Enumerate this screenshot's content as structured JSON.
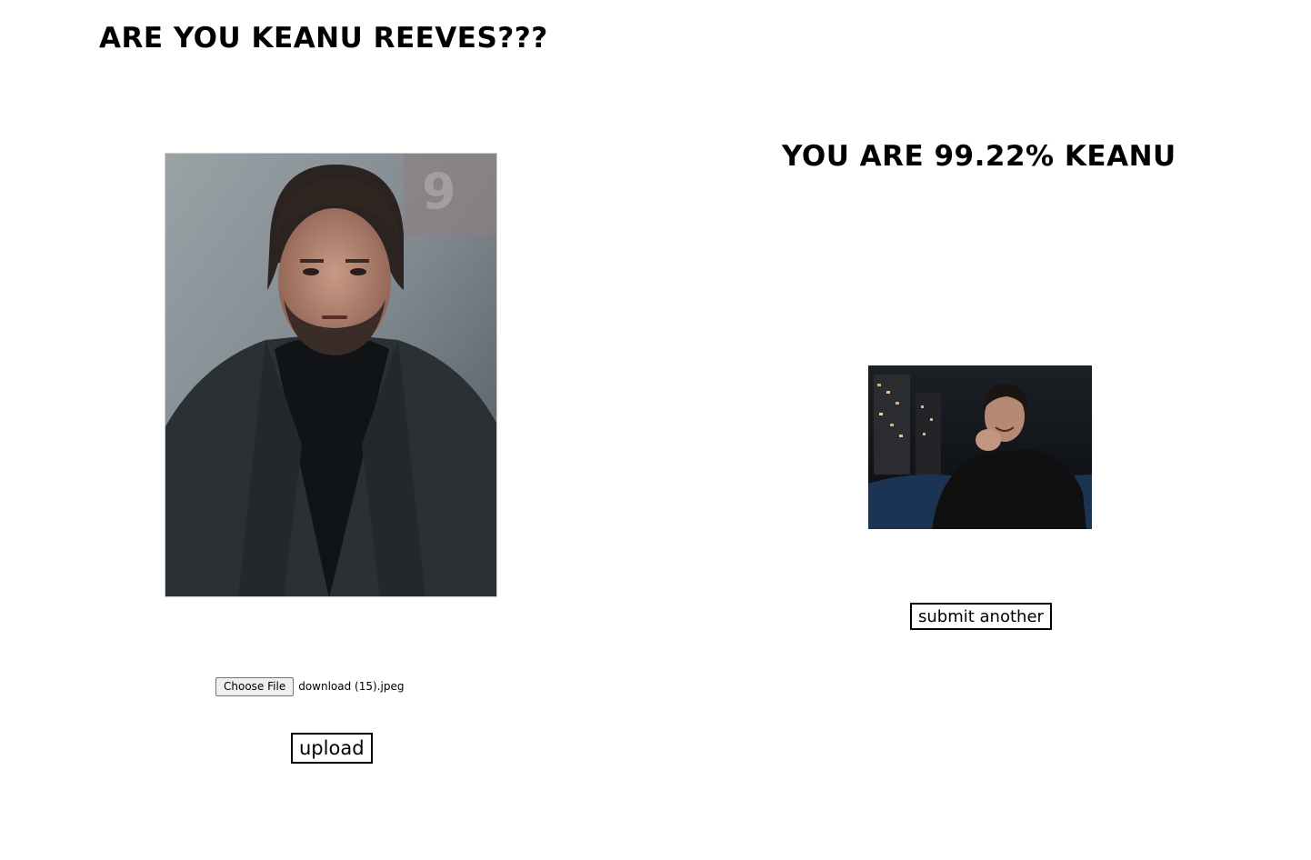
{
  "header": {
    "title": "ARE YOU KEANU REEVES???"
  },
  "upload_panel": {
    "choose_file_label": "Choose File",
    "file_name": "download (15).jpeg",
    "upload_label": "upload"
  },
  "result_panel": {
    "result_text": "YOU ARE 99.22% KEANU",
    "submit_another_label": "submit another"
  }
}
